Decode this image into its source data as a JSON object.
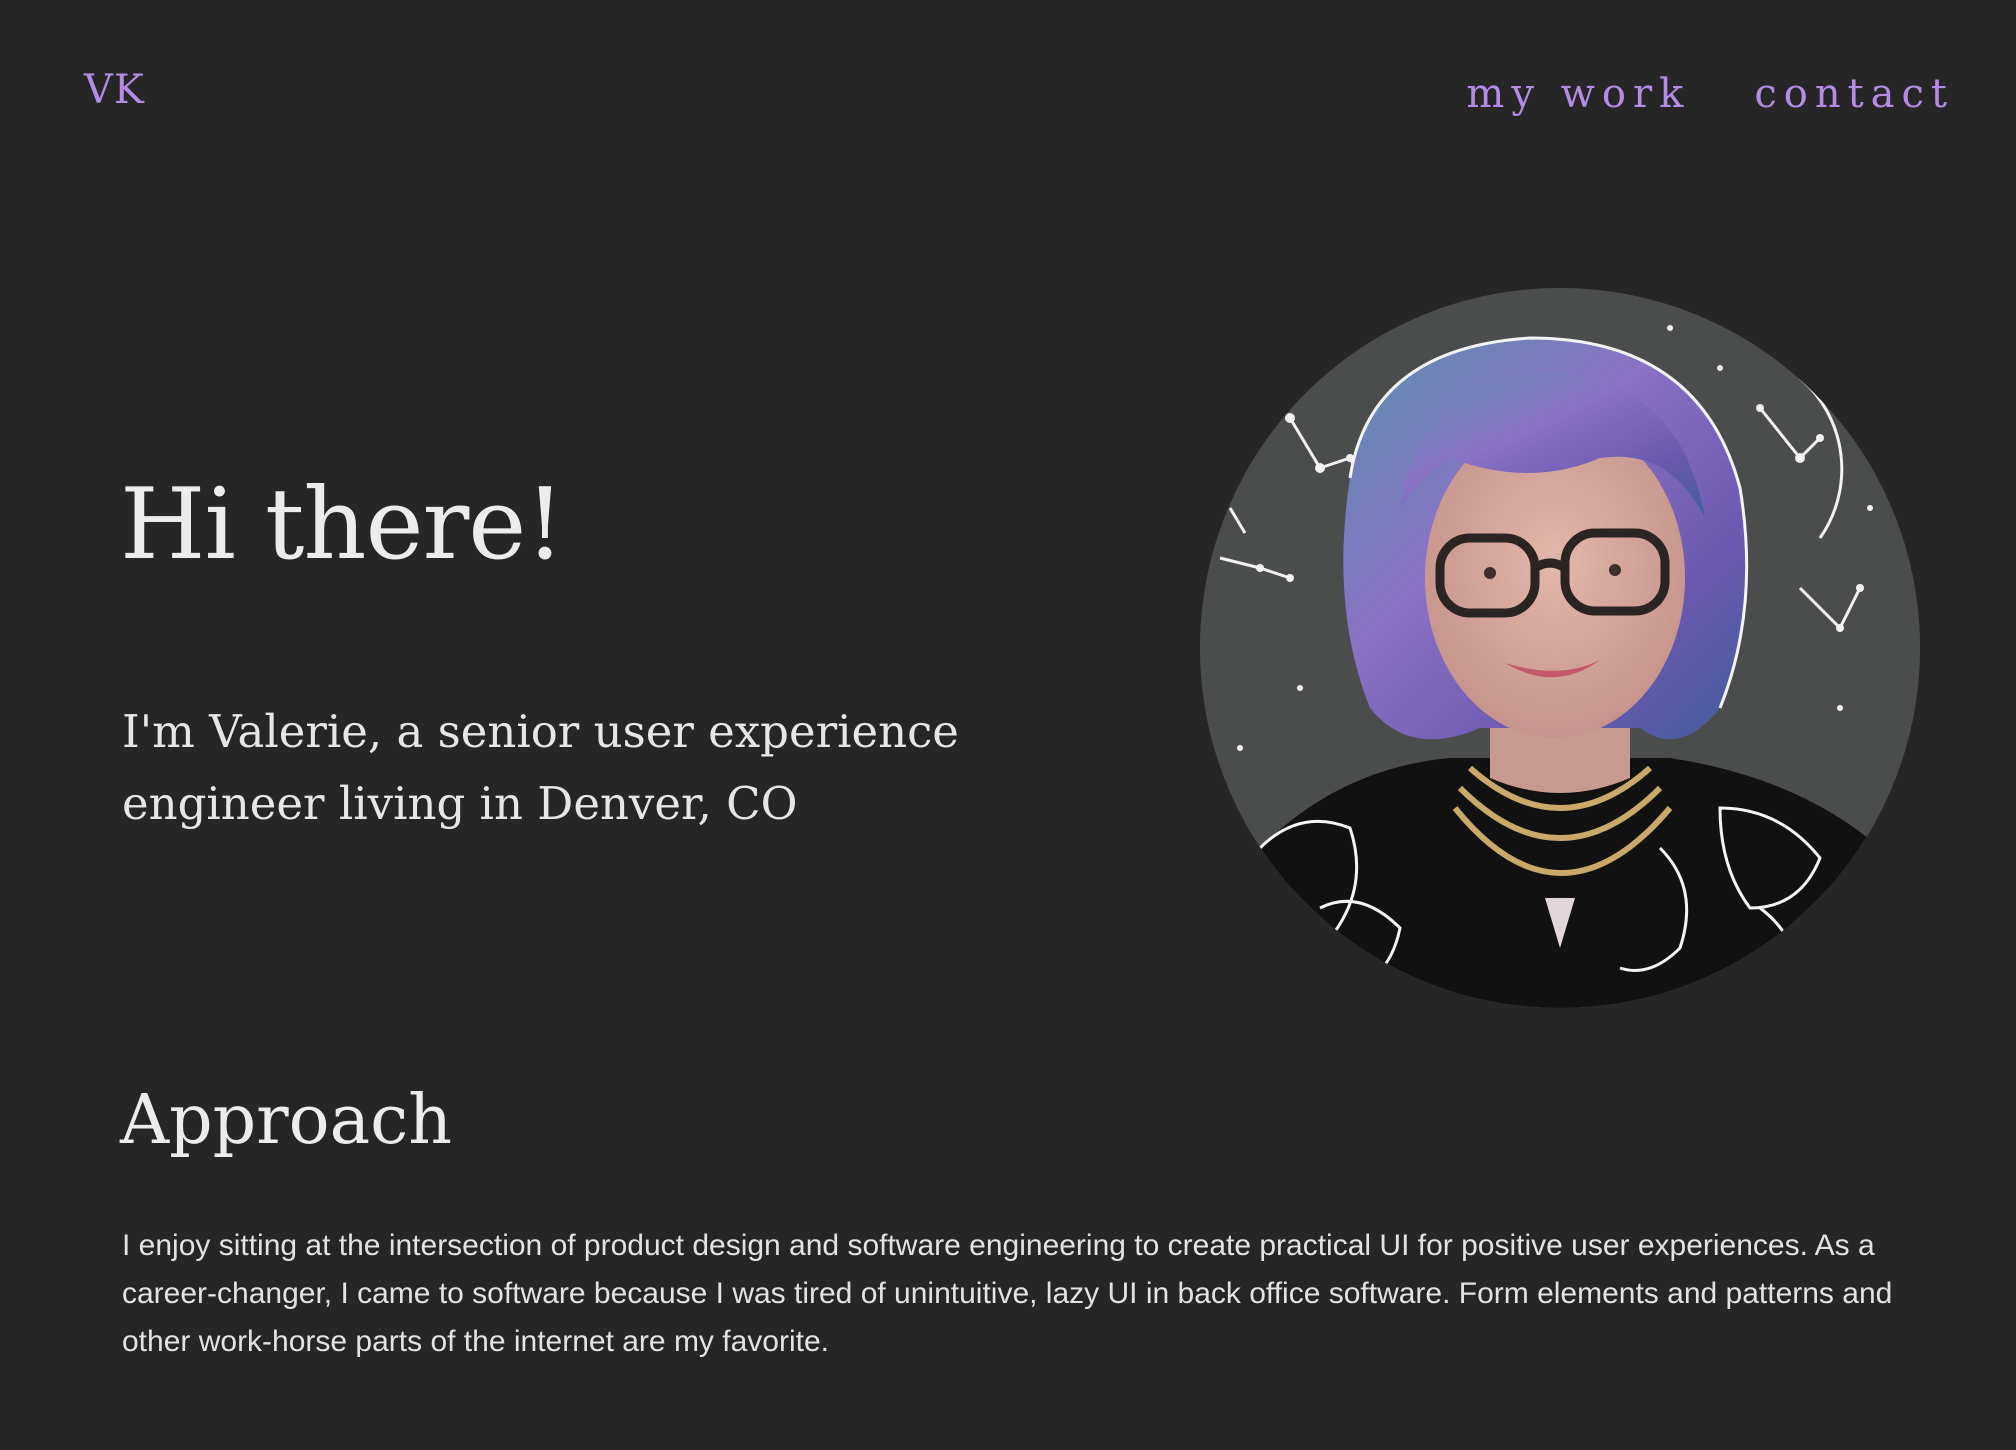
{
  "header": {
    "logo": "VK",
    "nav": [
      {
        "label": "my work"
      },
      {
        "label": "contact"
      }
    ]
  },
  "hero": {
    "title": "Hi there!",
    "subtitle": "I'm Valerie, a senior user experience engineer living in Denver, CO",
    "portrait_alt": "portrait-photo"
  },
  "approach": {
    "title": "Approach",
    "body": "I enjoy sitting at the intersection of product design and software engineering to create practical UI for positive user experiences. As a career-changer, I came to software because I was tired of unintuitive, lazy UI in back office software. Form elements and patterns and other work-horse parts of the internet are my favorite."
  },
  "colors": {
    "background": "#262626",
    "accent": "#b48be6",
    "text": "#ececec"
  }
}
